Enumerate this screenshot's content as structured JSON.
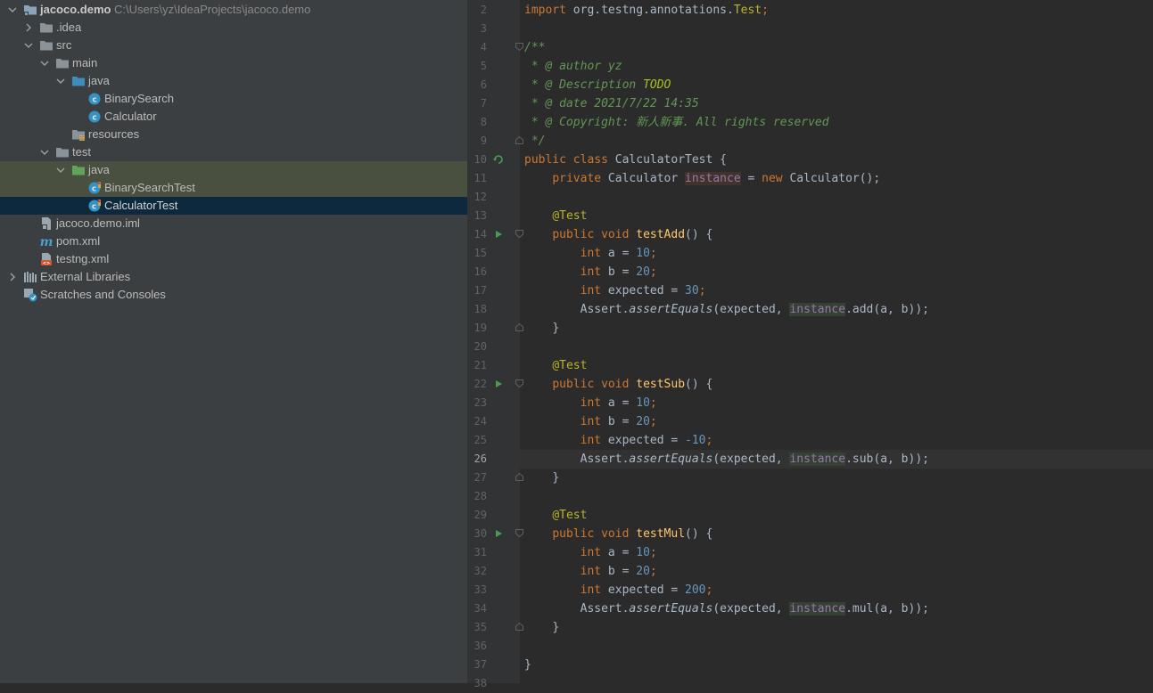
{
  "tree": {
    "project_name": "jacoco.demo",
    "project_path": "C:\\Users\\yz\\IdeaProjects\\jacoco.demo",
    "idea": ".idea",
    "src": "src",
    "main": "main",
    "java_main": "java",
    "binary_search": "BinarySearch",
    "calculator": "Calculator",
    "resources": "resources",
    "test": "test",
    "java_test": "java",
    "binary_search_test": "BinarySearchTest",
    "calculator_test": "CalculatorTest",
    "iml": "jacoco.demo.iml",
    "pom": "pom.xml",
    "testng": "testng.xml",
    "external_libraries": "External Libraries",
    "scratches": "Scratches and Consoles"
  },
  "editor": {
    "current_line": "26",
    "line_numbers": [
      "2",
      "3",
      "4",
      "5",
      "6",
      "7",
      "8",
      "9",
      "10",
      "11",
      "12",
      "13",
      "14",
      "15",
      "16",
      "17",
      "18",
      "19",
      "20",
      "21",
      "22",
      "23",
      "24",
      "25",
      "26",
      "27",
      "28",
      "29",
      "30",
      "31",
      "32",
      "33",
      "34",
      "35",
      "36",
      "37",
      "38"
    ],
    "tokens": {
      "import": "import",
      "import_path": " org.testng.annotations.",
      "import_cls": "Test",
      "semi": ";",
      "doc_open": "/**",
      "doc_author": " * @ author yz",
      "doc_desc_pre": " * @ Description ",
      "doc_todo": "TODO",
      "doc_date": " * @ date 2021/7/22 14:35",
      "doc_copy": " * @ Copyright: 新人新事. All rights reserved",
      "doc_close": " */",
      "public": "public",
      "class": "class",
      "class_name": " CalculatorTest {",
      "private": "private",
      "calc_type": " Calculator ",
      "instance": "instance",
      "assign_new": " = ",
      "new": "new",
      "new_rest": " Calculator();",
      "at_test": "@Test",
      "void": "void",
      "test_add": "testAdd",
      "test_sub": "testSub",
      "test_mul": "testMul",
      "sig_rest": "() {",
      "int": "int",
      "var_a": " a = ",
      "var_b": " b = ",
      "var_expected": " expected = ",
      "n10": "10",
      "n20": "20",
      "n30": "30",
      "nm10": "-10",
      "n200": "200",
      "assert_pre": "Assert.",
      "assert_eq": "assertEquals",
      "assert_args": "(expected, ",
      "inst_a": "instan",
      "inst_b": "ce",
      "add_call": ".add(a, b));",
      "sub_call": ".sub(a, b));",
      "mul_call": ".mul(a, b));",
      "close_brace": "}"
    }
  }
}
